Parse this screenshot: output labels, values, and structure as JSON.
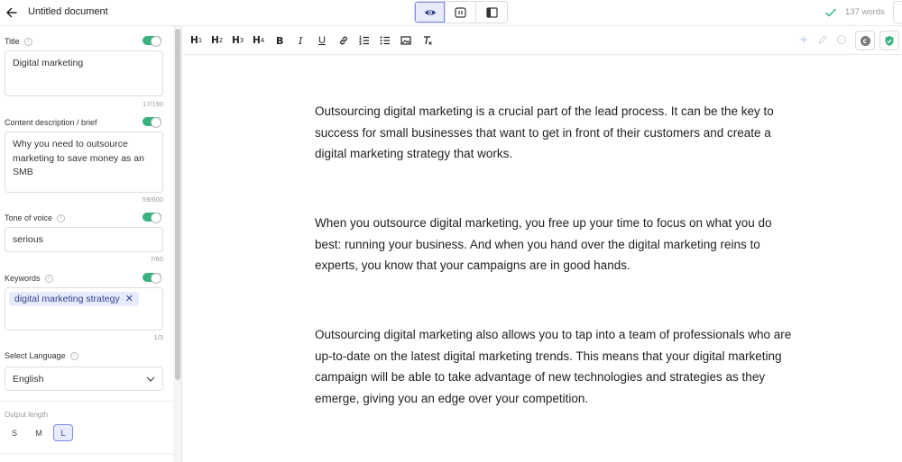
{
  "header": {
    "document_title": "Untitled document",
    "word_count": "137 words",
    "views": [
      {
        "icon": "eye-icon",
        "active": true
      },
      {
        "icon": "split-view-icon",
        "active": false
      },
      {
        "icon": "sidebar-view-icon",
        "active": false
      }
    ]
  },
  "sidebar": {
    "title": {
      "label": "Title",
      "value": "Digital marketing",
      "counter": "17/150",
      "enabled": true
    },
    "description": {
      "label": "Content description / brief",
      "value": "Why you need to outsource marketing to save money as an SMB",
      "counter": "59/600",
      "enabled": true
    },
    "tone": {
      "label": "Tone of voice",
      "value": "serious",
      "counter": "7/60",
      "enabled": true
    },
    "keywords": {
      "label": "Keywords",
      "chips": [
        "digital marketing strategy"
      ],
      "counter": "1/3",
      "enabled": true
    },
    "language": {
      "label": "Select Language",
      "value": "English"
    },
    "output_length": {
      "label": "Output length",
      "options": [
        "S",
        "M",
        "L"
      ],
      "selected": "L"
    }
  },
  "toolbar": {
    "headings": [
      {
        "letter": "H",
        "level": "1"
      },
      {
        "letter": "H",
        "level": "2"
      },
      {
        "letter": "H",
        "level": "3"
      },
      {
        "letter": "H",
        "level": "4"
      }
    ],
    "bold": "B",
    "italic": "I",
    "underline": "U"
  },
  "editor": {
    "paragraphs": [
      "Outsourcing digital marketing is a crucial part of the lead process.  It can be the key to success for small businesses that want to get in front of their customers and create a digital marketing strategy that works.",
      "When you outsource digital marketing, you free up your time to focus on what you do best: running your business. And when you hand over the digital marketing reins to experts, you know that your campaigns are in good hands.",
      "Outsourcing digital marketing also allows you to tap into a team of professionals who are up-to-date on the latest digital marketing trends. This means that your digital marketing campaign will be able to take advantage of new technologies and strategies as they emerge, giving you an edge over your competition."
    ]
  },
  "colors": {
    "accent": "#7d8ce6",
    "accent_bg": "#e8ebfb",
    "toggle_on": "#36b37e",
    "check": "#36b37e"
  }
}
